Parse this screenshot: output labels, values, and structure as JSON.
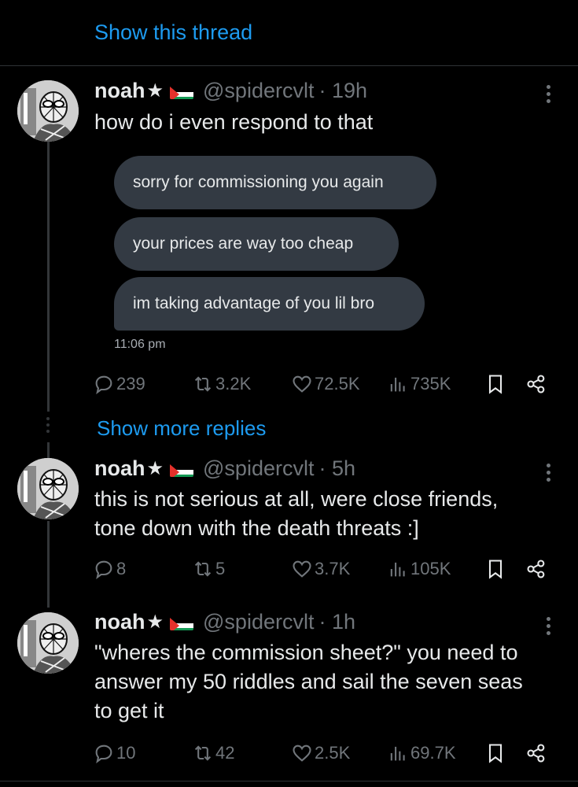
{
  "show_thread": "Show this thread",
  "show_more_replies": "Show more replies",
  "colors": {
    "background": "#000000",
    "link": "#1d9bf0",
    "muted": "#71767b",
    "text": "#e7e9ea",
    "bubble": "#333a43"
  },
  "posts": [
    {
      "name": "noah",
      "handle": "@spidercvlt",
      "time": "· 19h",
      "text": "how do i even respond to that",
      "bubbles": [
        "sorry for commissioning you again",
        "your prices are way too cheap",
        "im taking advantage of you lil bro"
      ],
      "bubble_time": "11:06 pm",
      "replies": "239",
      "reposts": "3.2K",
      "likes": "72.5K",
      "views": "735K"
    },
    {
      "name": "noah",
      "handle": "@spidercvlt",
      "time": "· 5h",
      "text_lines": [
        "this is not serious at all, were close friends,",
        "tone down with the death threats :]"
      ],
      "replies": "8",
      "reposts": "5",
      "likes": "3.7K",
      "views": "105K"
    },
    {
      "name": "noah",
      "handle": "@spidercvlt",
      "time": "· 1h",
      "text_lines": [
        "\"wheres the commission sheet?\" you need to",
        "answer my 50 riddles and sail the seven seas",
        "to get it"
      ],
      "replies": "10",
      "reposts": "42",
      "likes": "2.5K",
      "views": "69.7K"
    }
  ]
}
